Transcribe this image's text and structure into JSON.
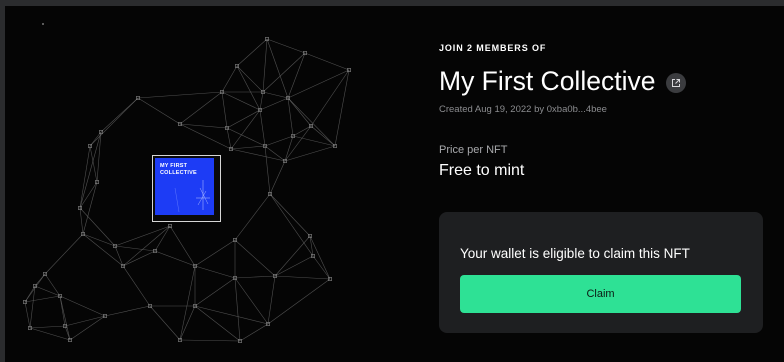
{
  "collective": {
    "eyebrow": "JOIN 2 MEMBERS OF",
    "title": "My First Collective",
    "meta": "Created Aug 19, 2022 by 0xba0b...4bee",
    "external_link_icon": "external-link-icon"
  },
  "nft": {
    "title": "MY FIRST COLLECTIVE"
  },
  "pricing": {
    "label": "Price per NFT",
    "value": "Free to mint"
  },
  "claim": {
    "message": "Your wallet is eligible to claim this NFT",
    "button_label": "Claim"
  },
  "colors": {
    "background": "#050505",
    "accent": "#2ee195",
    "nft_blue": "#1d3cf5",
    "card": "#1e1f21"
  }
}
